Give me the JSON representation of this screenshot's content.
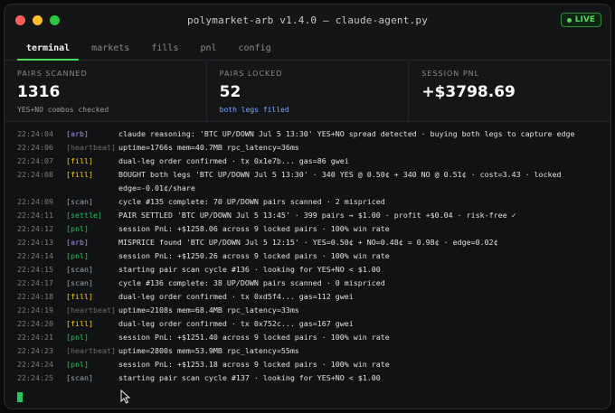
{
  "window": {
    "title": "polymarket-arb v1.4.0 — claude-agent.py",
    "live_label": "LIVE"
  },
  "tabs": [
    "terminal",
    "markets",
    "fills",
    "pnl",
    "config"
  ],
  "stats": [
    {
      "label": "PAIRS SCANNED",
      "value": "1316",
      "sub": "YES+NO combos checked"
    },
    {
      "label": "PAIRS LOCKED",
      "value": "52",
      "sub": "both legs filled"
    },
    {
      "label": "SESSION PNL",
      "value": "+$3798.69",
      "sub": ""
    }
  ],
  "colors": {
    "arb": "#a78bfa",
    "heartbeat": "#6b6b6b",
    "fill": "#facc15",
    "scan": "#9aa0a6",
    "settle": "#22c55e",
    "pnl": "#22c55e",
    "accent": "#4ade57"
  },
  "log": [
    {
      "time": "22:24:04",
      "tag": "[arb]",
      "kind": "arb",
      "msg": "claude reasoning: 'BTC UP/DOWN Jul 5 13:30' YES+NO spread detected · buying both legs to capture edge"
    },
    {
      "time": "22:24:06",
      "tag": "[heartbeat]",
      "kind": "heartbeat",
      "msg": "uptime=1766s mem=40.7MB rpc_latency=36ms"
    },
    {
      "time": "22:24:07",
      "tag": "[fill]",
      "kind": "fill",
      "msg": "dual-leg order confirmed · tx 0x1e7b... gas=86 gwei"
    },
    {
      "time": "22:24:08",
      "tag": "[fill]",
      "kind": "fill",
      "msg": "BOUGHT both legs 'BTC UP/DOWN Jul 5 13:30' · 340 YES @ 0.50¢ + 340 NO @ 0.51¢ · cost=3.43 · locked"
    },
    {
      "time": "",
      "tag": "",
      "kind": "fill",
      "msg": "edge=-0.01¢/share"
    },
    {
      "time": "22:24:09",
      "tag": "[scan]",
      "kind": "scan",
      "msg": "cycle #135 complete: 70 UP/DOWN pairs scanned · 2 mispriced"
    },
    {
      "time": "22:24:11",
      "tag": "[settle]",
      "kind": "settle",
      "msg": "PAIR SETTLED 'BTC UP/DOWN Jul 5 13:45' · 399 pairs → $1.00 · profit +$0.04 · risk-free ✓"
    },
    {
      "time": "22:24:12",
      "tag": "[pnl]",
      "kind": "pnl",
      "msg": "session PnL: +$1258.06 across 9 locked pairs · 100% win rate"
    },
    {
      "time": "22:24:13",
      "tag": "[arb]",
      "kind": "arb",
      "msg": "MISPRICE found 'BTC UP/DOWN Jul 5 12:15' · YES=0.50¢ + NO=0.48¢ = 0.98¢ · edge=0.02¢"
    },
    {
      "time": "22:24:14",
      "tag": "[pnl]",
      "kind": "pnl",
      "msg": "session PnL: +$1250.26 across 9 locked pairs · 100% win rate"
    },
    {
      "time": "22:24:15",
      "tag": "[scan]",
      "kind": "scan",
      "msg": "starting pair scan cycle #136 · looking for YES+NO < $1.00"
    },
    {
      "time": "22:24:17",
      "tag": "[scan]",
      "kind": "scan",
      "msg": "cycle #136 complete: 38 UP/DOWN pairs scanned · 0 mispriced"
    },
    {
      "time": "22:24:18",
      "tag": "[fill]",
      "kind": "fill",
      "msg": "dual-leg order confirmed · tx 0xd5f4... gas=112 gwei"
    },
    {
      "time": "22:24:19",
      "tag": "[heartbeat]",
      "kind": "heartbeat",
      "msg": "uptime=2108s mem=68.4MB rpc_latency=33ms"
    },
    {
      "time": "22:24:20",
      "tag": "[fill]",
      "kind": "fill",
      "msg": "dual-leg order confirmed · tx 0x752c... gas=167 gwei"
    },
    {
      "time": "22:24:21",
      "tag": "[pnl]",
      "kind": "pnl",
      "msg": "session PnL: +$1251.40 across 9 locked pairs · 100% win rate"
    },
    {
      "time": "22:24:23",
      "tag": "[heartbeat]",
      "kind": "heartbeat",
      "msg": "uptime=2800s mem=53.9MB rpc_latency=55ms"
    },
    {
      "time": "22:24:24",
      "tag": "[pnl]",
      "kind": "pnl",
      "msg": "session PnL: +$1253.18 across 9 locked pairs · 100% win rate"
    },
    {
      "time": "22:24:25",
      "tag": "[scan]",
      "kind": "scan",
      "msg": "starting pair scan cycle #137 · looking for YES+NO < $1.00"
    }
  ]
}
